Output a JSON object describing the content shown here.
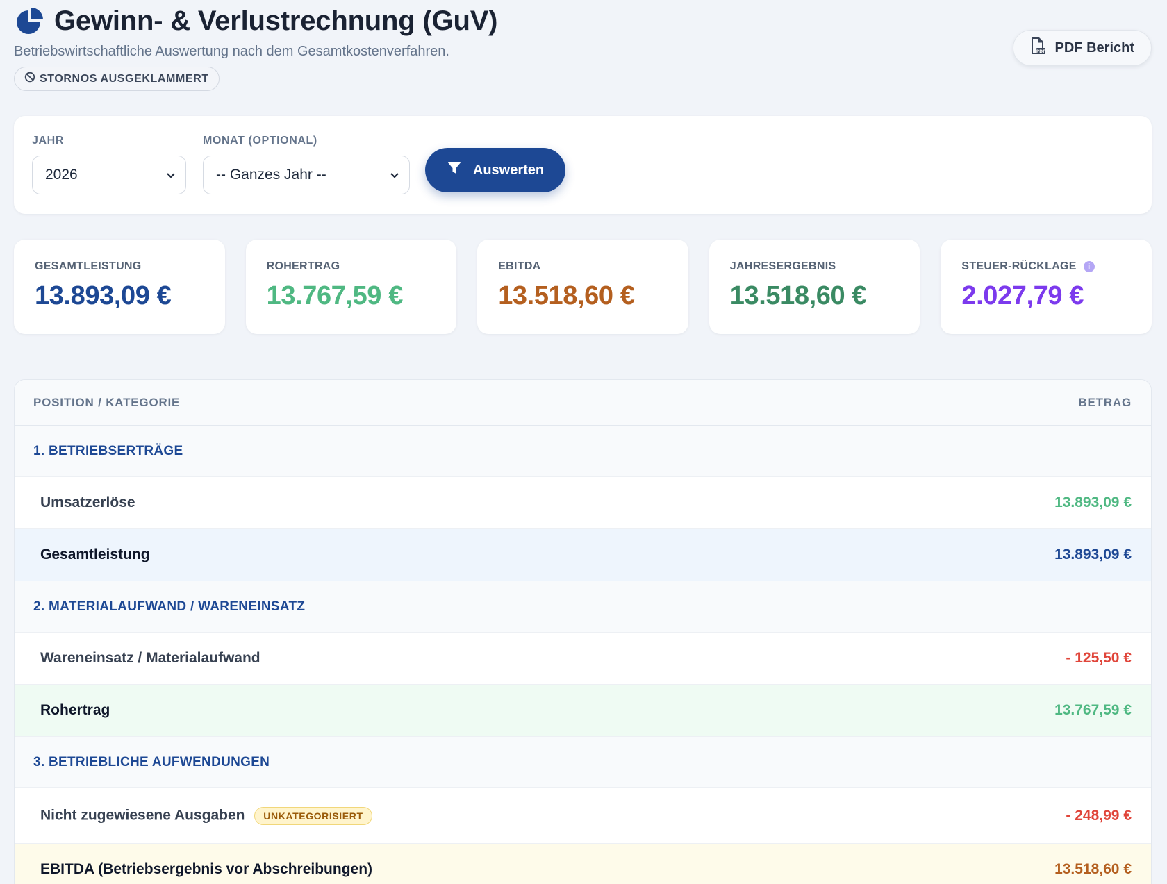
{
  "header": {
    "title": "Gewinn- & Verlustrechnung (GuV)",
    "subtitle": "Betriebswirtschaftliche Auswertung nach dem Gesamtkostenverfahren.",
    "badge": "STORNOS AUSGEKLAMMERT",
    "pdf_button": "PDF Bericht"
  },
  "filters": {
    "year_label": "JAHR",
    "year_value": "2026",
    "month_label": "MONAT (OPTIONAL)",
    "month_value": "-- Ganzes Jahr --",
    "submit_label": "Auswerten"
  },
  "kpis": [
    {
      "label": "GESAMTLEISTUNG",
      "value": "13.893,09 €",
      "color": "#1d4894"
    },
    {
      "label": "ROHERTRAG",
      "value": "13.767,59 €",
      "color": "#4fb882"
    },
    {
      "label": "EBITDA",
      "value": "13.518,60 €",
      "color": "#b45f1f"
    },
    {
      "label": "JAHRESERGEBNIS",
      "value": "13.518,60 €",
      "color": "#3a8a63"
    },
    {
      "label": "STEUER-RÜCKLAGE",
      "value": "2.027,79 €",
      "color": "#7c3aed"
    }
  ],
  "table": {
    "col_position": "POSITION / KATEGORIE",
    "col_amount": "BETRAG",
    "rows": [
      {
        "label": "1. BETRIEBSERTRÄGE"
      },
      {
        "label": "Umsatzerlöse",
        "amount": "13.893,09 €"
      },
      {
        "label": "Gesamtleistung",
        "amount": "13.893,09 €"
      },
      {
        "label": "2. MATERIALAUFWAND / WARENEINSATZ"
      },
      {
        "label": "Wareneinsatz / Materialaufwand",
        "amount": "- 125,50 €"
      },
      {
        "label": "Rohertrag",
        "amount": "13.767,59 €"
      },
      {
        "label": "3. BETRIEBLICHE AUFWENDUNGEN"
      },
      {
        "label": "Nicht zugewiesene Ausgaben",
        "tag": "UNKATEGORISIERT",
        "amount": "- 248,99 €"
      },
      {
        "label": "EBITDA (Betriebsergebnis vor Abschreibungen)",
        "amount": "13.518,60 €"
      }
    ]
  },
  "colors": {
    "primary": "#1d4894",
    "positive": "#4fb882",
    "negative": "#e0453a",
    "ebitda": "#b45f1f",
    "tax": "#7c3aed"
  }
}
